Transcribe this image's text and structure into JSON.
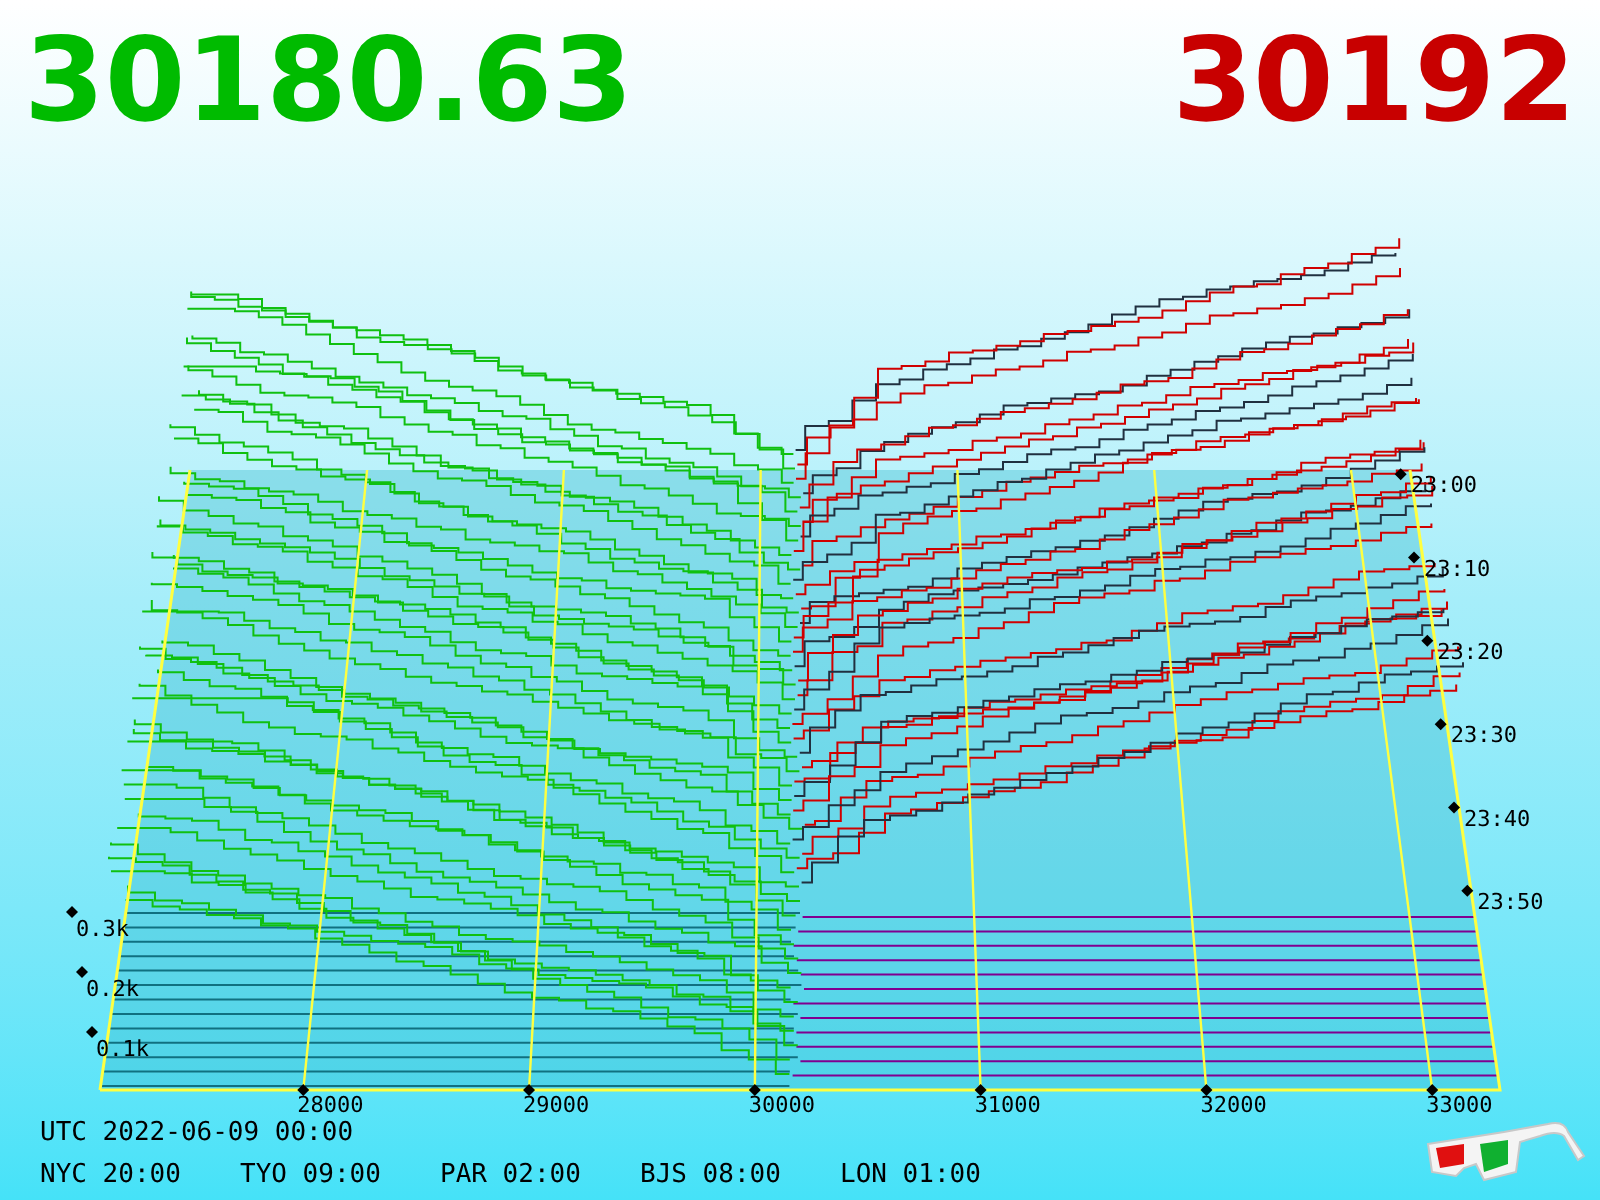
{
  "bid_price": "30180.63",
  "ask_price": "30192",
  "chart": {
    "volume_ticks": [
      "0.3k",
      "0.2k",
      "0.1k"
    ],
    "price_ticks": [
      "28000",
      "29000",
      "30000",
      "31000",
      "32000",
      "33000"
    ],
    "time_ticks": [
      "23:00",
      "23:10",
      "23:20",
      "23:30",
      "23:40",
      "23:50"
    ]
  },
  "utc_time": "UTC 2022-06-09 00:00",
  "city_times": [
    "NYC 20:00",
    "TYO 09:00",
    "PAR 02:00",
    "BJS 08:00",
    "LON 01:00"
  ]
}
